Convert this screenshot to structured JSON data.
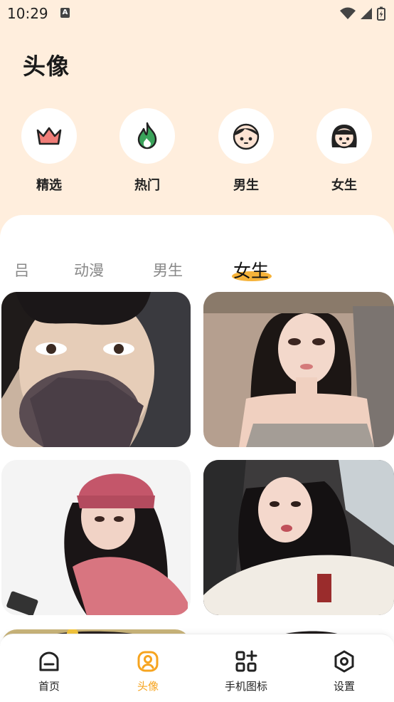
{
  "status_bar": {
    "time": "10:29",
    "notification_glyph": "A"
  },
  "header": {
    "title": "头像"
  },
  "categories": [
    {
      "label": "精选",
      "icon": "crown-icon"
    },
    {
      "label": "热门",
      "icon": "flame-icon"
    },
    {
      "label": "男生",
      "icon": "boy-face-icon"
    },
    {
      "label": "女生",
      "icon": "girl-face-icon"
    }
  ],
  "tabs": [
    {
      "label": "动漫"
    },
    {
      "label": "男生"
    },
    {
      "label": "女生",
      "active": true
    }
  ],
  "tabs_partial": "吕",
  "bottom_nav": [
    {
      "label": "首页",
      "icon": "home-icon"
    },
    {
      "label": "头像",
      "icon": "avatar-icon",
      "active": true
    },
    {
      "label": "手机图标",
      "icon": "apps-icon"
    },
    {
      "label": "设置",
      "icon": "settings-icon"
    }
  ],
  "colors": {
    "background": "#ffeedd",
    "accent": "#f6a41f",
    "highlight": "#f6b33a"
  }
}
